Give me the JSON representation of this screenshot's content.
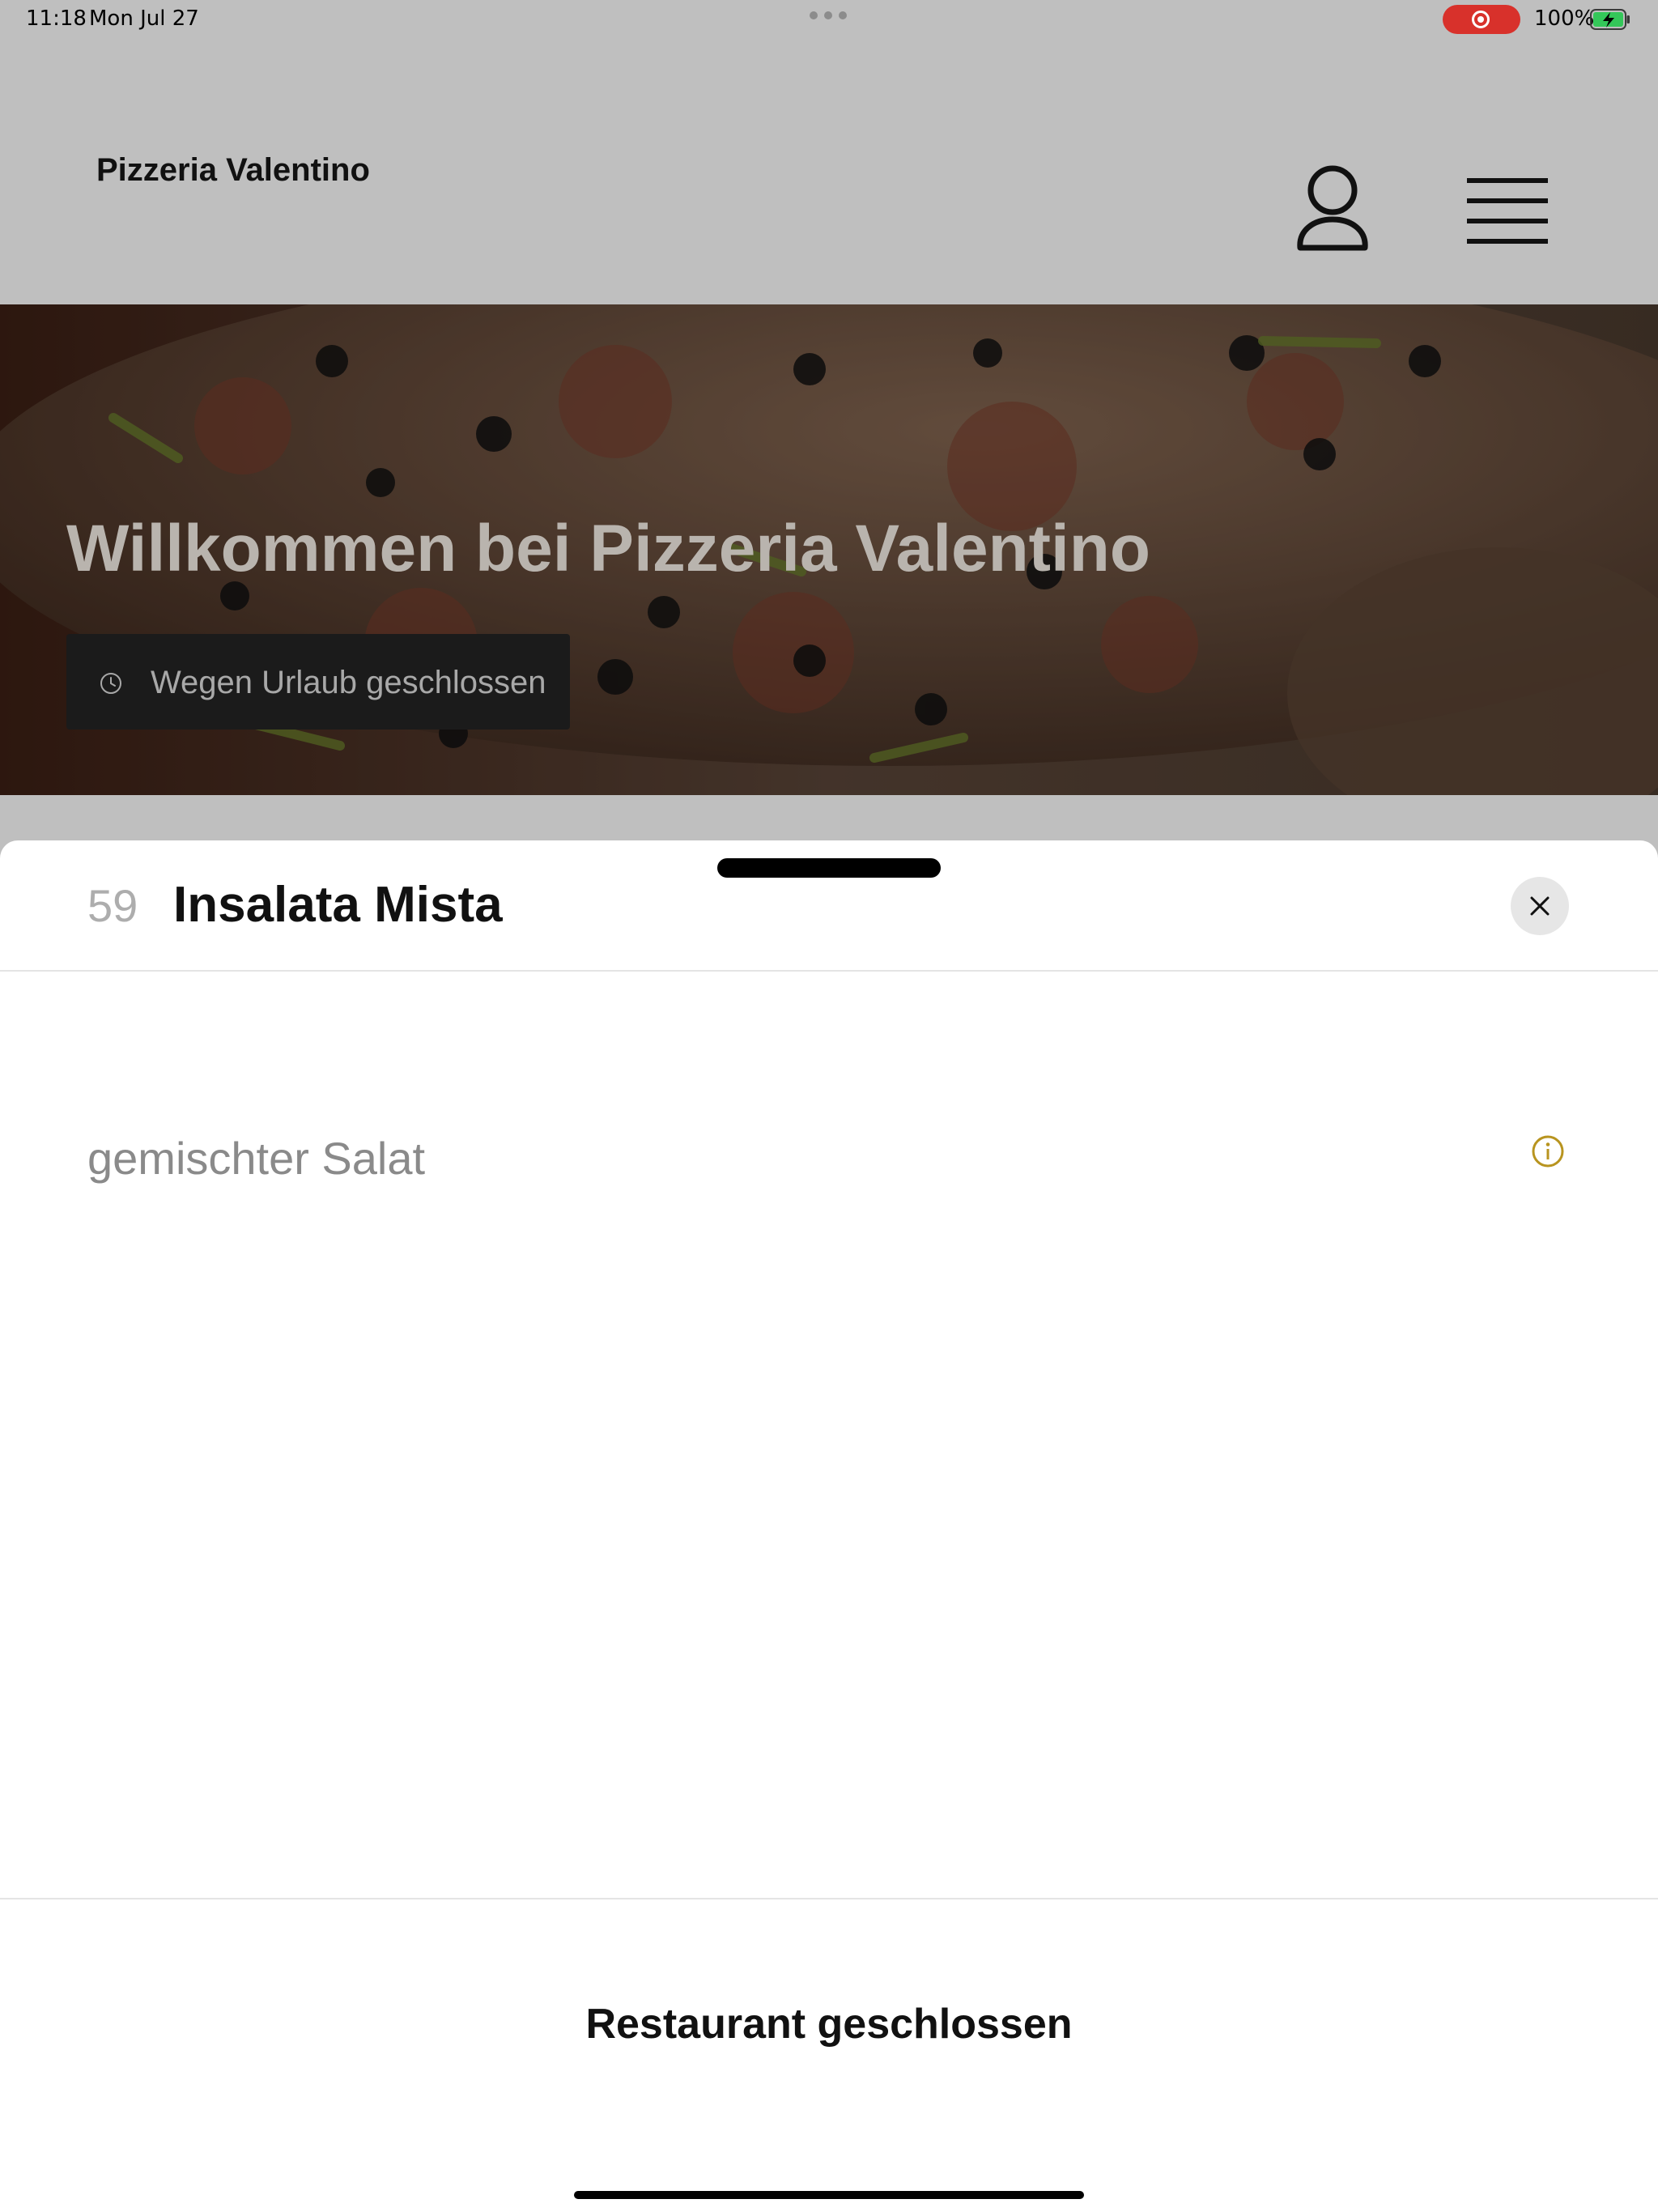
{
  "status_bar": {
    "time": "11:18",
    "date": "Mon Jul 27",
    "battery": "100%",
    "icons": [
      "screen-recording-icon",
      "battery-charging-icon"
    ],
    "recording_color": "#d8312b",
    "battery_color": "#34c759"
  },
  "header": {
    "brand": "Pizzeria Valentino",
    "icons": [
      "user-profile-icon",
      "hamburger-menu-icon"
    ]
  },
  "hero": {
    "title": "Willkommen bei Pizzeria Valentino",
    "badge": "Wegen Urlaub geschlossen",
    "badge_icon": "clock-icon"
  },
  "sheet": {
    "item_number": "59",
    "item_title": "Insalata Mista",
    "description": "gemischter Salat",
    "info_icon": "info-icon",
    "info_color": "#b8941f",
    "close_icon": "close-icon",
    "status": "Restaurant geschlossen"
  }
}
